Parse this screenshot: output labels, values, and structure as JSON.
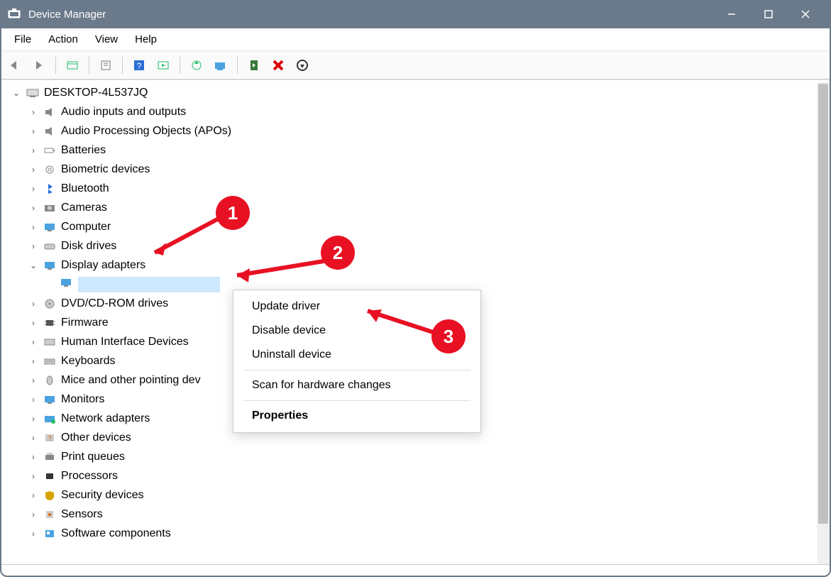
{
  "window": {
    "title": "Device Manager"
  },
  "menu": {
    "file": "File",
    "action": "Action",
    "view": "View",
    "help": "Help"
  },
  "root": {
    "name": "DESKTOP-4L537JQ"
  },
  "categories": [
    {
      "label": "Audio inputs and outputs",
      "icon": "speaker"
    },
    {
      "label": "Audio Processing Objects (APOs)",
      "icon": "speaker"
    },
    {
      "label": "Batteries",
      "icon": "battery"
    },
    {
      "label": "Biometric devices",
      "icon": "fingerprint"
    },
    {
      "label": "Bluetooth",
      "icon": "bluetooth"
    },
    {
      "label": "Cameras",
      "icon": "camera"
    },
    {
      "label": "Computer",
      "icon": "monitor"
    },
    {
      "label": "Disk drives",
      "icon": "disk"
    },
    {
      "label": "Display adapters",
      "icon": "monitor",
      "expanded": true
    },
    {
      "label": "DVD/CD-ROM drives",
      "icon": "disc"
    },
    {
      "label": "Firmware",
      "icon": "chip"
    },
    {
      "label": "Human Interface Devices",
      "icon": "hid"
    },
    {
      "label": "Keyboards",
      "icon": "keyboard"
    },
    {
      "label": "Mice and other pointing dev",
      "icon": "mouse"
    },
    {
      "label": "Monitors",
      "icon": "monitor"
    },
    {
      "label": "Network adapters",
      "icon": "network"
    },
    {
      "label": "Other devices",
      "icon": "question"
    },
    {
      "label": "Print queues",
      "icon": "printer"
    },
    {
      "label": "Processors",
      "icon": "cpu"
    },
    {
      "label": "Security devices",
      "icon": "shield"
    },
    {
      "label": "Sensors",
      "icon": "sensor"
    },
    {
      "label": "Software components",
      "icon": "software"
    }
  ],
  "contextMenu": {
    "update": "Update driver",
    "disable": "Disable device",
    "uninstall": "Uninstall device",
    "scan": "Scan for hardware changes",
    "properties": "Properties"
  },
  "badges": {
    "b1": "1",
    "b2": "2",
    "b3": "3"
  }
}
